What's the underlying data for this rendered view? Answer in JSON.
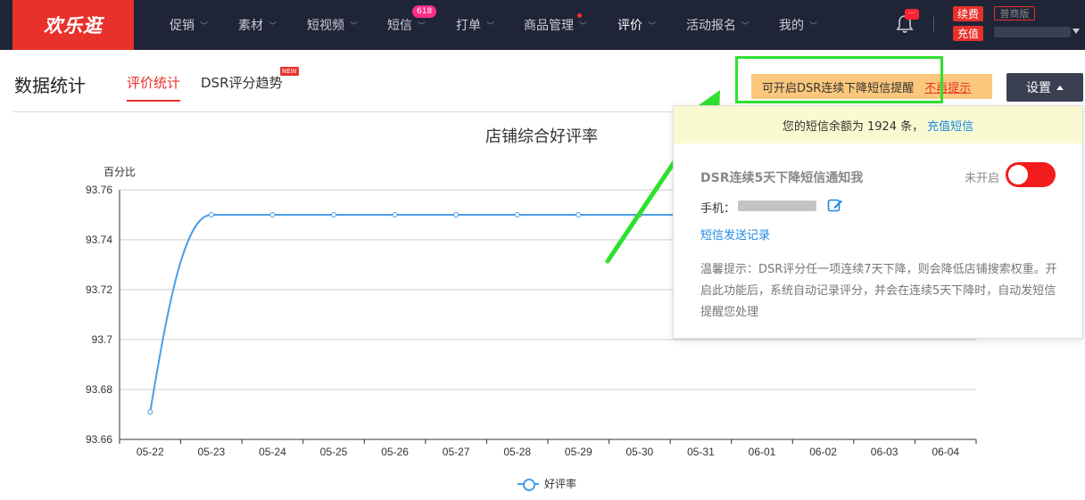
{
  "brand": {
    "logo_text": "欢乐逛",
    "accent": "#e8312a",
    "nav_bg": "#1f2537"
  },
  "nav": {
    "items": [
      {
        "label": "促销"
      },
      {
        "label": "素材"
      },
      {
        "label": "短视频"
      },
      {
        "label": "短信",
        "badge": "618"
      },
      {
        "label": "打单"
      },
      {
        "label": "商品管理"
      },
      {
        "label": "评价"
      },
      {
        "label": "活动报名"
      },
      {
        "label": "我的"
      }
    ],
    "bell_badge": "···",
    "renew_label": "续费",
    "recharge_label": "充值",
    "edition_label": "普商版"
  },
  "page": {
    "title": "数据统计",
    "tabs": [
      {
        "label": "评价统计"
      },
      {
        "label": "DSR评分趋势"
      }
    ],
    "new_tag": "NEW"
  },
  "tip": {
    "text": "可开启DSR连续下降短信提醒",
    "dismiss": "不再提示"
  },
  "settings_label": "设置",
  "popover": {
    "balance_text": "您的短信余额为 1924 条，",
    "recharge_link": "充值短信",
    "title": "DSR连续5天下降短信通知我",
    "toggle_state_label": "未开启",
    "phone_label": "手机：",
    "sms_log_link": "短信发送记录",
    "hint": "温馨提示：DSR评分任一项连续7天下降，则会降低店铺搜索权重。开启此功能后，系统自动记录评分，并会在连续5天下降时，自动发短信提醒您处理"
  },
  "chart_data": {
    "type": "line",
    "title": "店铺综合好评率",
    "ylabel": "百分比",
    "categories": [
      "05-22",
      "05-23",
      "05-24",
      "05-25",
      "05-26",
      "05-27",
      "05-28",
      "05-29",
      "05-30",
      "05-31",
      "06-01",
      "06-02",
      "06-03",
      "06-04"
    ],
    "series": [
      {
        "name": "好评率",
        "values": [
          93.671,
          93.75,
          93.75,
          93.75,
          93.75,
          93.75,
          93.75,
          93.75,
          93.75,
          93.75,
          93.75,
          93.75,
          93.75,
          93.75
        ],
        "color": "#4a9ee8"
      }
    ],
    "ylim": [
      93.66,
      93.76
    ],
    "yticks": [
      93.76,
      93.74,
      93.72,
      93.7,
      93.68,
      93.66
    ],
    "ytick_labels": [
      "93.76",
      "93.74",
      "93.72",
      "93.7",
      "93.68",
      "93.66"
    ],
    "grid": true,
    "legend": "bottom"
  }
}
